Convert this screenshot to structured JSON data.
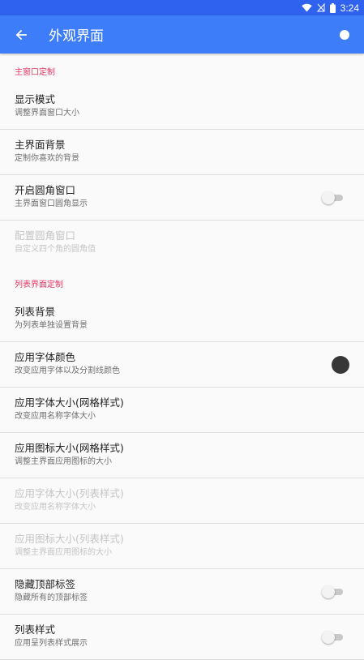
{
  "status_bar": {
    "time": "3:24",
    "accent": "#2f62ee"
  },
  "app_bar": {
    "title": "外观界面",
    "accent": "#3d7df9"
  },
  "sections": [
    {
      "header": "主窗口定制"
    },
    {
      "header": "列表界面定制"
    }
  ],
  "items": [
    {
      "title": "显示模式",
      "subtitle": "调整界面窗口大小"
    },
    {
      "title": "主界面背景",
      "subtitle": "定制你喜欢的背景"
    },
    {
      "title": "开启圆角窗口",
      "subtitle": "主界面窗口圆角显示",
      "toggle": false
    },
    {
      "title": "配置圆角窗口",
      "subtitle": "自定义四个角的圆角值",
      "enabled": false
    },
    {
      "title": "列表背景",
      "subtitle": "为列表单独设置背景"
    },
    {
      "title": "应用字体颜色",
      "subtitle": "改变应用字体以及分割线颜色",
      "color": "#373737"
    },
    {
      "title": "应用字体大小(网格样式)",
      "subtitle": "改变应用名称字体大小"
    },
    {
      "title": "应用图标大小(网格样式)",
      "subtitle": "调整主界面应用图标的大小"
    },
    {
      "title": "应用字体大小(列表样式)",
      "subtitle": "改变应用名称字体大小",
      "enabled": false
    },
    {
      "title": "应用图标大小(列表样式)",
      "subtitle": "调整主界面应用图标的大小",
      "enabled": false
    },
    {
      "title": "隐藏顶部标签",
      "subtitle": "隐藏所有的顶部标签",
      "toggle": false
    },
    {
      "title": "列表样式",
      "subtitle": "应用呈列表样式展示",
      "toggle": false
    }
  ],
  "icons": {
    "back": "arrow-back-icon",
    "more": "circle-dot-icon",
    "wifi": "wifi-icon",
    "signal": "no-signal-icon",
    "battery": "battery-icon"
  }
}
